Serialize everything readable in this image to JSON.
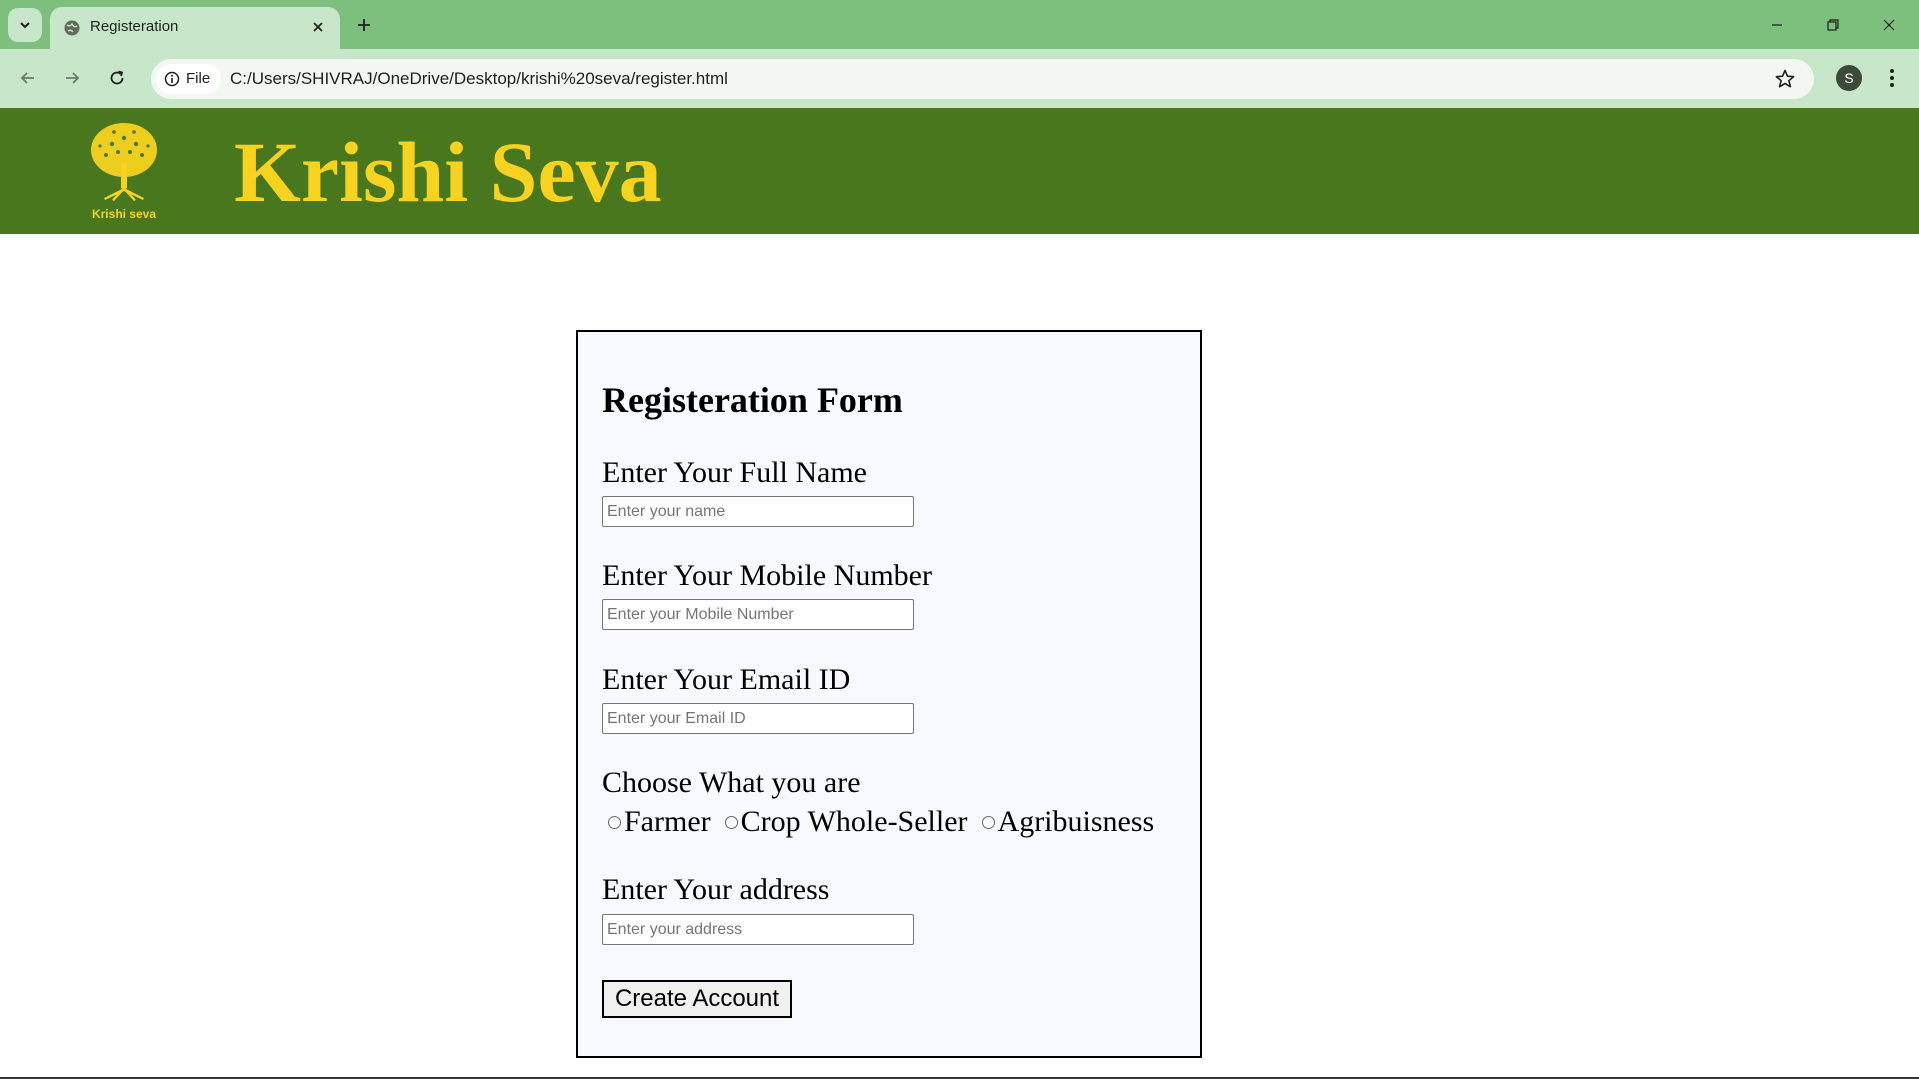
{
  "browser": {
    "tab_title": "Registeration",
    "site_chip_label": "File",
    "url": "C:/Users/SHIVRAJ/OneDrive/Desktop/krishi%20seva/register.html",
    "profile_initial": "S"
  },
  "header": {
    "logo_text": "Krishi seva",
    "site_title": "Krishi Seva"
  },
  "form": {
    "title": "Registeration Form",
    "name_label": "Enter Your Full Name",
    "name_placeholder": "Enter your name",
    "mobile_label": "Enter Your Mobile Number",
    "mobile_placeholder": "Enter your Mobile Number",
    "email_label": "Enter Your Email ID",
    "email_placeholder": "Enter your Email ID",
    "role_label": "Choose What you are",
    "role_options": [
      "Farmer",
      "Crop Whole-Seller",
      "Agribuisness"
    ],
    "address_label": "Enter Your address",
    "address_placeholder": "Enter your address",
    "submit_label": "Create Account"
  },
  "colors": {
    "tabstrip": "#7dbf7d",
    "toolbar": "#c8e6c9",
    "header_bg": "#48771e",
    "brand_yellow": "#f7d21e",
    "form_bg": "#f8f8ff"
  },
  "icons": {
    "tab_search": "chevron-down-icon",
    "favicon": "globe-icon",
    "tab_close": "close-icon",
    "new_tab": "plus-icon",
    "back": "arrow-left-icon",
    "forward": "arrow-right-icon",
    "reload": "reload-icon",
    "site_info": "info-icon",
    "bookmark": "star-icon",
    "menu": "kebab-menu-icon",
    "minimize": "minimize-icon",
    "restore": "restore-icon",
    "close_window": "close-icon",
    "logo": "tree-logo-icon"
  }
}
